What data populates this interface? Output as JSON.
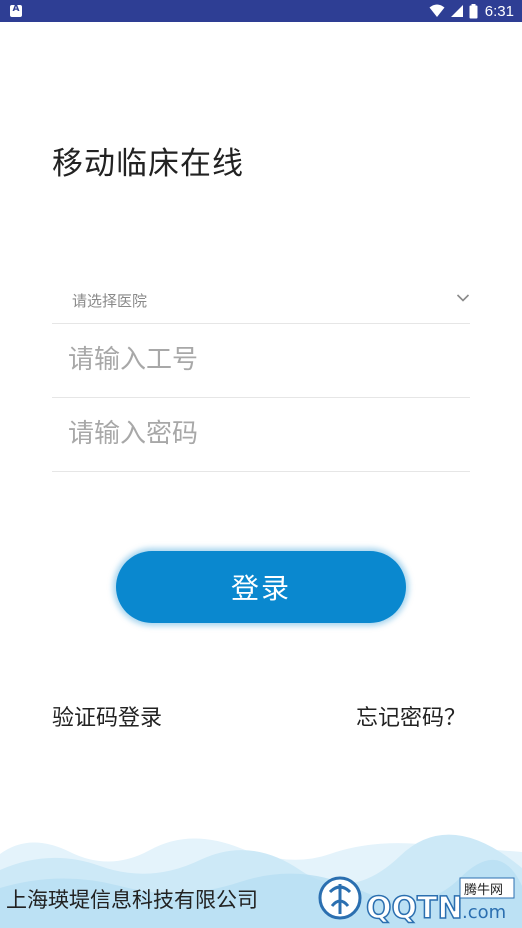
{
  "status_bar": {
    "app_icon_letter": "A",
    "time": "6:31",
    "icons": [
      "wifi-icon",
      "cell-signal-icon",
      "battery-icon"
    ]
  },
  "app": {
    "title": "移动临床在线"
  },
  "form": {
    "hospital_placeholder": "请选择医院",
    "employee_id_placeholder": "请输入工号",
    "password_placeholder": "请输入密码"
  },
  "actions": {
    "login_label": "登录",
    "sms_login_label": "验证码登录",
    "forgot_password_label": "忘记密码？"
  },
  "footer": {
    "company": "上海瑛堤信息科技有限公司",
    "watermark_text": "QQTN",
    "watermark_domain": ".com",
    "watermark_site": "腾牛网"
  },
  "colors": {
    "status_bar": "#2e3e94",
    "primary": "#0a88cf",
    "wave_light": "#dceff9",
    "wave_mid": "#b8dff3"
  }
}
